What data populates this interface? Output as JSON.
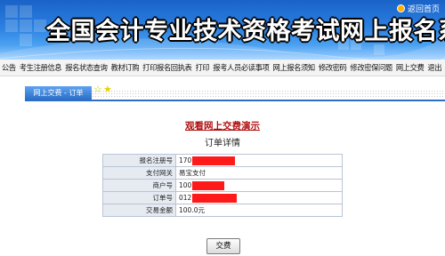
{
  "banner": {
    "title": "全国会计专业技术资格考试网上报名系统",
    "return_link": "返回首页"
  },
  "nav": {
    "items": [
      "公告",
      "考生注册信息",
      "报名状态查询",
      "教材订购",
      "打印报名回执表",
      "打印",
      "报考人员必读事项",
      "网上报名须知",
      "修改密码",
      "修改密保问题",
      "网上交费",
      "退出"
    ]
  },
  "tab": {
    "label": "网上交费 - 订单"
  },
  "content": {
    "demo_link": "观看网上交费演示",
    "detail_title": "订单详情",
    "rows": [
      {
        "label": "报名注册号",
        "value": "170"
      },
      {
        "label": "支付网关",
        "value": "易宝支付"
      },
      {
        "label": "商户号",
        "value": "100"
      },
      {
        "label": "订单号",
        "value": "012"
      },
      {
        "label": "交易金额",
        "value": "100.0元"
      }
    ],
    "submit_button": "交费"
  },
  "colors": {
    "banner_blue": "#2a7fe0",
    "tab_blue": "#2b6fc8",
    "link_red": "#b01010",
    "redaction": "#ff1a1a"
  }
}
